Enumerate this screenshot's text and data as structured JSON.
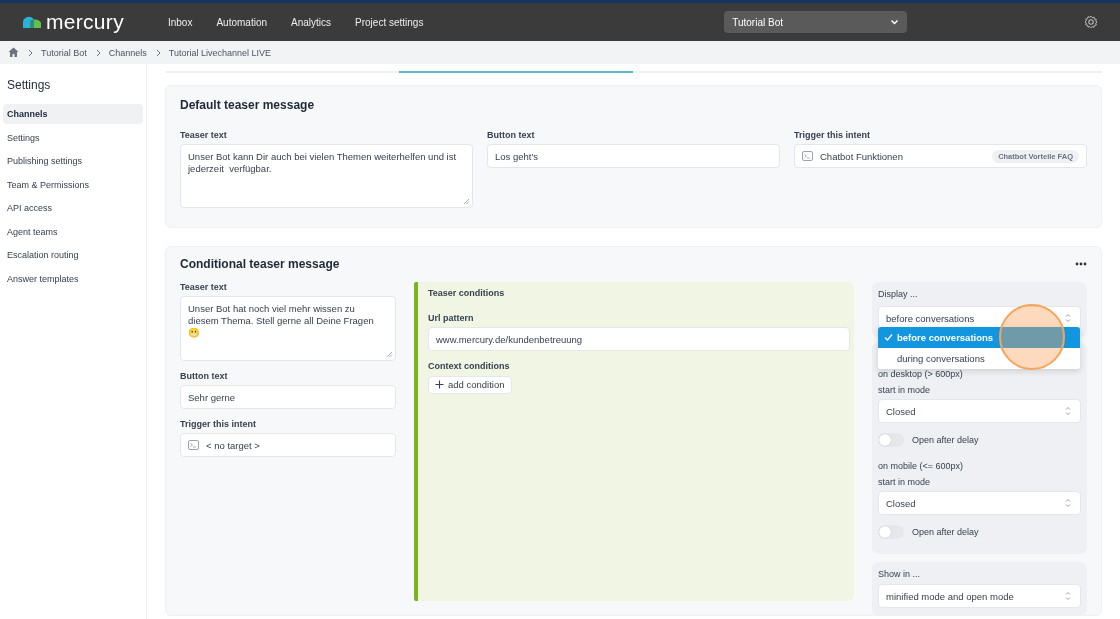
{
  "topbar": {
    "logo": "mercury",
    "nav": [
      {
        "label": "Inbox"
      },
      {
        "label": "Automation"
      },
      {
        "label": "Analytics"
      },
      {
        "label": "Project settings"
      }
    ],
    "bot_select": "Tutorial Bot"
  },
  "breadcrumbs": [
    "Tutorial Bot",
    "Channels",
    "Tutorial Livechannel LIVE"
  ],
  "sidebar": {
    "title": "Settings",
    "items": [
      {
        "label": "Channels",
        "selected": true
      },
      {
        "label": "Settings",
        "selected": false
      },
      {
        "label": "Publishing settings",
        "selected": false
      },
      {
        "label": "Team & Permissions",
        "selected": false
      },
      {
        "label": "API access",
        "selected": false
      },
      {
        "label": "Agent teams",
        "selected": false
      },
      {
        "label": "Escalation routing",
        "selected": false
      },
      {
        "label": "Answer templates",
        "selected": false
      }
    ]
  },
  "default_teaser": {
    "title": "Default teaser message",
    "teaser_label": "Teaser text",
    "teaser_text": "Unser Bot kann Dir auch bei vielen Themen weiterhelfen und ist jederzeit  verfügbar.",
    "button_label": "Button text",
    "button_text": "Los geht's",
    "intent_label": "Trigger this intent",
    "intent": "Chatbot Funktionen",
    "intent_tag": "Chatbot Vorteile FAQ"
  },
  "conditional_teaser": {
    "title": "Conditional teaser message",
    "teaser_label": "Teaser text",
    "teaser_text": "Unser Bot hat noch viel mehr wissen zu diesem Thema. Stell gerne all Deine Fragen 😬",
    "button_label": "Button text",
    "button_text": "Sehr gerne",
    "intent_label": "Trigger this intent",
    "intent": "< no target >",
    "conditions": {
      "title": "Teaser conditions",
      "url_label": "Url pattern",
      "url": "www.mercury.de/kundenbetreuung",
      "context_label": "Context conditions",
      "add_button": "add condition"
    },
    "display": {
      "label": "Display ...",
      "value": "before conversations",
      "options": [
        {
          "label": "before conversations",
          "selected": true
        },
        {
          "label": "during conversations",
          "selected": false
        }
      ]
    },
    "devices": [
      {
        "label": "on desktop (> 600px)",
        "mode_label": "start in mode",
        "mode": "Closed",
        "delay_label": "Open after delay",
        "delay_on": false
      },
      {
        "label": "on mobile (<= 600px)",
        "mode_label": "start in mode",
        "mode": "Closed",
        "delay_label": "Open after delay",
        "delay_on": false
      }
    ],
    "show_in": {
      "label": "Show in ...",
      "value": "minified mode and open mode"
    }
  }
}
